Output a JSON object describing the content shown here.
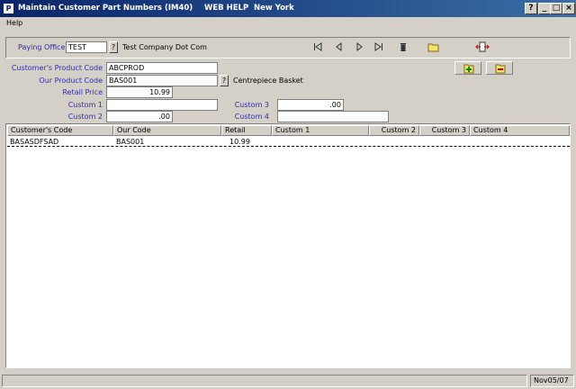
{
  "window": {
    "title": "Maintain Customer Part Numbers (IM40)",
    "help_caption": "WEB HELP",
    "location": "New York",
    "app_icon": "app-icon",
    "controls": [
      "help-icon",
      "minimize-icon",
      "maximize-icon",
      "close-icon"
    ],
    "help_glyph": "?",
    "min_glyph": "_",
    "max_glyph": "□",
    "close_glyph": "×"
  },
  "menu": {
    "items": [
      {
        "label": "Help"
      }
    ]
  },
  "paying_office": {
    "label": "Paying Office",
    "value": "TEST",
    "lookup": "?",
    "description": "Test Company Dot Com"
  },
  "nav": {
    "first": "first-record-icon",
    "prev": "previous-record-icon",
    "next": "next-record-icon",
    "last": "last-record-icon",
    "delete": "trash-icon",
    "open": "folder-icon",
    "exit": "exit-door-icon"
  },
  "form": {
    "customer_code": {
      "label": "Customer's Product Code",
      "value": "ABCPROD"
    },
    "our_code": {
      "label": "Our Product Code",
      "value": "BAS001",
      "lookup": "?",
      "description": "Centrepiece Basket"
    },
    "retail_price": {
      "label": "Retail Price",
      "value": "10.99"
    },
    "custom1": {
      "label": "Custom 1",
      "value": ""
    },
    "custom2": {
      "label": "Custom 2",
      "value": ".00"
    },
    "custom3": {
      "label": "Custom 3",
      "value": ".00"
    },
    "custom4": {
      "label": "Custom 4",
      "value": ""
    }
  },
  "actions": {
    "add": "add-record-icon",
    "remove": "remove-record-icon"
  },
  "grid": {
    "columns": [
      "Customer's Code",
      "Our Code",
      "Retail",
      "Custom 1",
      "Custom 2",
      "Custom 3",
      "Custom 4"
    ],
    "rows": [
      {
        "customer_code": "BASASDFSAD",
        "our_code": "BAS001",
        "retail": "10.99",
        "custom1": "",
        "custom2": "",
        "custom3": "",
        "custom4": ""
      }
    ]
  },
  "status": {
    "date": "Nov05/07"
  }
}
